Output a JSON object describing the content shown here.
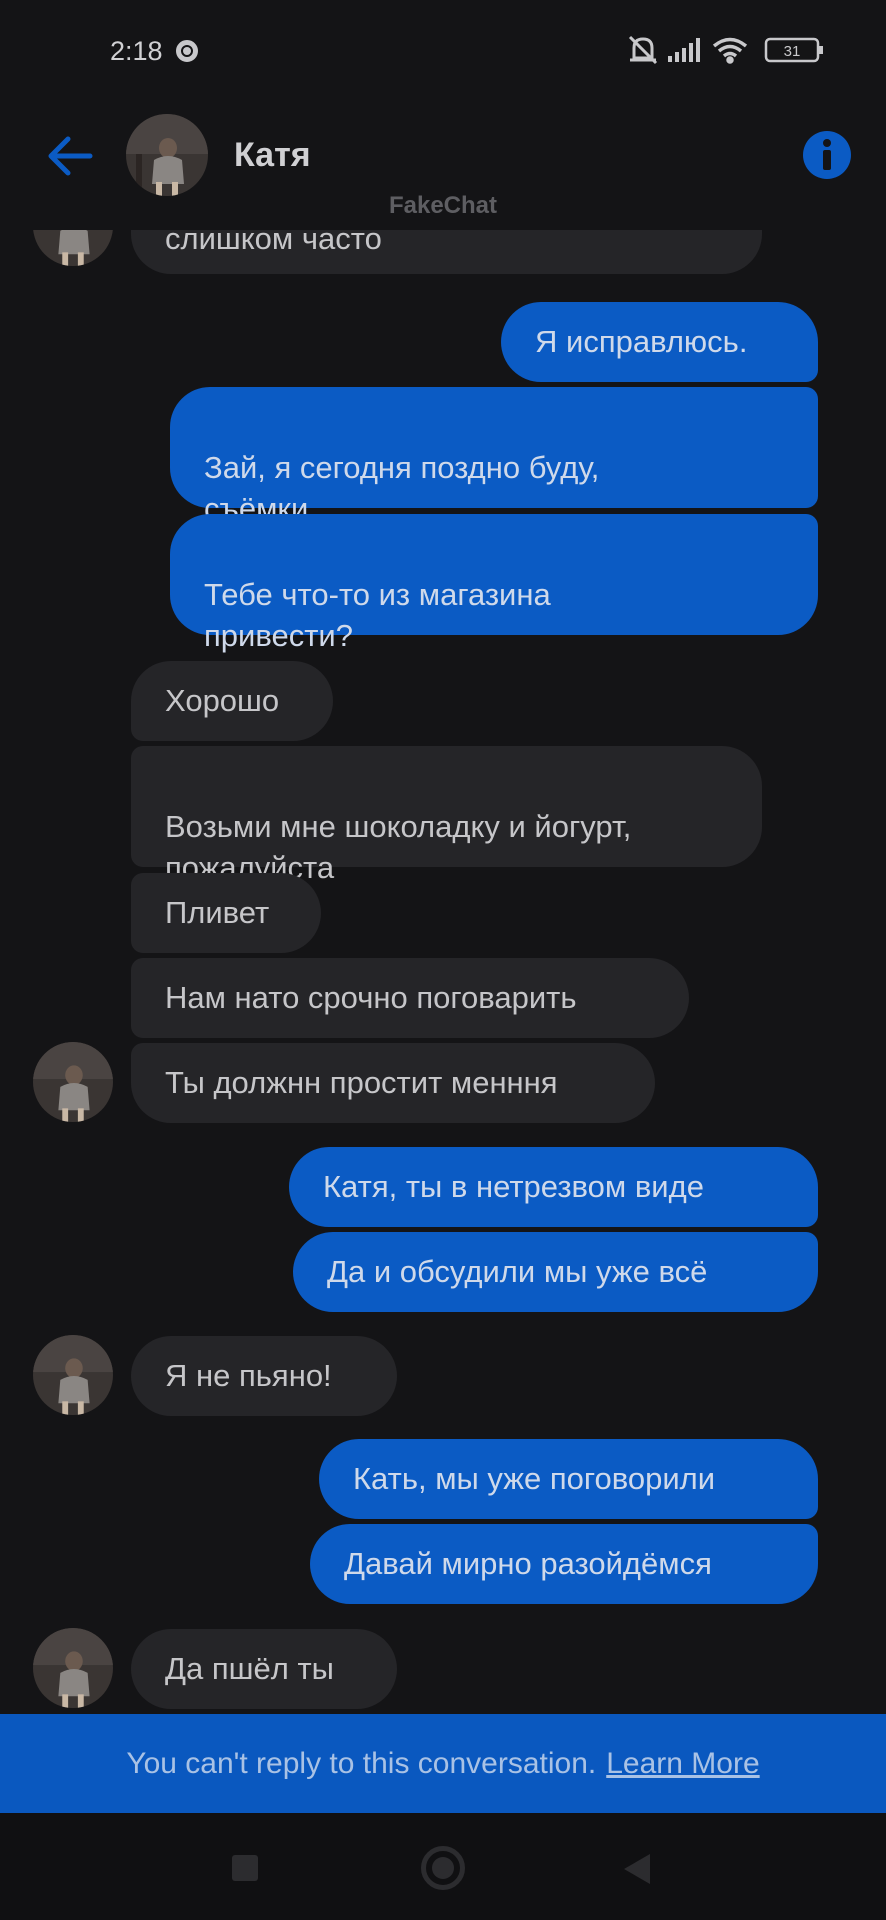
{
  "status_bar": {
    "time": "2:18",
    "battery": "31",
    "icons": [
      "chrome-icon",
      "mute-bell-icon",
      "signal-icon",
      "wifi-icon",
      "battery-icon"
    ]
  },
  "header": {
    "contact_name": "Катя",
    "watermark": "FakeChat",
    "icons": [
      "back-arrow-icon",
      "info-icon"
    ],
    "accent_color": "#0b5bc4"
  },
  "messages": [
    {
      "from": "them",
      "text": "слишком часто"
    },
    {
      "from": "me",
      "text": "Я исправлюсь."
    },
    {
      "from": "me",
      "text": "Зай, я сегодня поздно буду,\nсъёмки"
    },
    {
      "from": "me",
      "text": "Тебе что-то из магазина\nпривести?"
    },
    {
      "from": "them",
      "text": "Хорошо"
    },
    {
      "from": "them",
      "text": "Возьми мне шоколадку и йогурт,\nпожалуйста"
    },
    {
      "from": "them",
      "text": "Пливет"
    },
    {
      "from": "them",
      "text": "Нам нато срочно поговарить"
    },
    {
      "from": "them",
      "text": "Ты должнн  простит менння"
    },
    {
      "from": "me",
      "text": "Катя, ты в нетрезвом виде"
    },
    {
      "from": "me",
      "text": "Да и обсудили мы уже всё"
    },
    {
      "from": "them",
      "text": "Я не пьяно!"
    },
    {
      "from": "me",
      "text": "Кать, мы уже поговорили"
    },
    {
      "from": "me",
      "text": "Давай мирно разойдёмся"
    },
    {
      "from": "them",
      "text": "Да пшёл ты"
    }
  ],
  "banner": {
    "text": "You can't reply to this conversation.",
    "link": "Learn More",
    "color": "#0a58bf"
  },
  "nav_bar": {
    "icons": [
      "recents-icon",
      "home-icon",
      "back-icon"
    ]
  }
}
